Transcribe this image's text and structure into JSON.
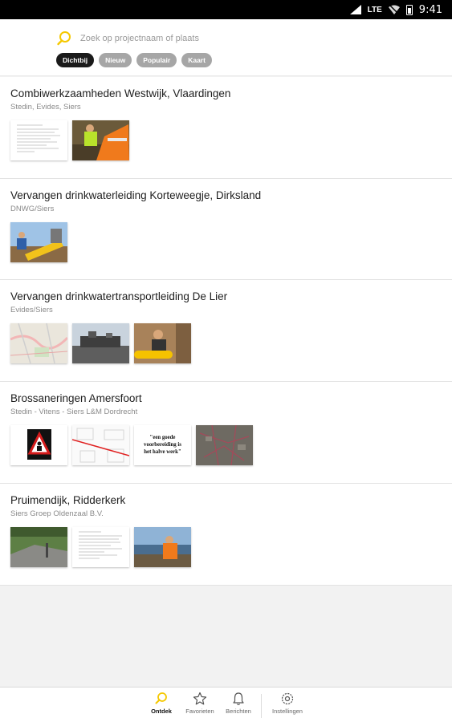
{
  "status_bar": {
    "network": "LTE",
    "time": "9:41"
  },
  "search": {
    "placeholder": "Zoek op projectnaam of plaats"
  },
  "filters": [
    {
      "label": "Dichtbij",
      "active": true
    },
    {
      "label": "Nieuw",
      "active": false
    },
    {
      "label": "Populair",
      "active": false
    },
    {
      "label": "Kaart",
      "active": false
    }
  ],
  "projects": [
    {
      "title": "Combiwerkzaamheden Westwijk, Vlaardingen",
      "subtitle": "Stedin, Evides, Siers"
    },
    {
      "title": "Vervangen drinkwaterleiding Korteweegje, Dirksland",
      "subtitle": "DNWG/Siers"
    },
    {
      "title": "Vervangen drinkwatertransportleiding De Lier",
      "subtitle": "Evides/Siers"
    },
    {
      "title": "Brossaneringen Amersfoort",
      "subtitle": "Stedin - Vitens - Siers L&M Dordrecht",
      "thumb_quote": "\"een goede voorbereiding is het halve werk\""
    },
    {
      "title": "Pruimendijk, Ridderkerk",
      "subtitle": "Siers Groep Oldenzaal B.V."
    }
  ],
  "nav": [
    {
      "label": "Ontdek",
      "icon": "search-icon",
      "active": true
    },
    {
      "label": "Favorieten",
      "icon": "star-icon",
      "active": false
    },
    {
      "label": "Berichten",
      "icon": "bell-icon",
      "active": false
    },
    {
      "label": "Instellingen",
      "icon": "gear-icon",
      "active": false
    }
  ],
  "colors": {
    "accent": "#f5c800",
    "chip_active": "#1a1a1a",
    "chip_inactive": "#a6a6a6"
  }
}
